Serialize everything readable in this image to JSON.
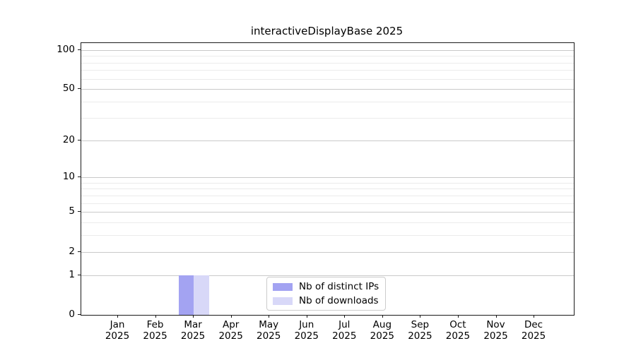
{
  "chart_data": {
    "type": "bar",
    "title": "interactiveDisplayBase 2025",
    "categories": [
      "Jan",
      "Feb",
      "Mar",
      "Apr",
      "May",
      "Jun",
      "Jul",
      "Aug",
      "Sep",
      "Oct",
      "Nov",
      "Dec"
    ],
    "x_year_label": "2025",
    "series": [
      {
        "name": "Nb of distinct IPs",
        "color": "#a3a3f2",
        "values": [
          0,
          0,
          1,
          0,
          0,
          0,
          0,
          0,
          0,
          0,
          0,
          0
        ]
      },
      {
        "name": "Nb of downloads",
        "color": "#d8d8f8",
        "values": [
          0,
          0,
          1,
          0,
          0,
          0,
          0,
          0,
          0,
          0,
          0,
          0
        ]
      }
    ],
    "yscale": "log1p",
    "ylim": [
      0,
      113
    ],
    "yticks": [
      0,
      1,
      2,
      5,
      10,
      20,
      50,
      100
    ],
    "minor_yticks": [
      3,
      4,
      6,
      7,
      8,
      9,
      30,
      40,
      60,
      70,
      80,
      90
    ],
    "grid": true,
    "legend_position": "inside-bottom-center"
  }
}
